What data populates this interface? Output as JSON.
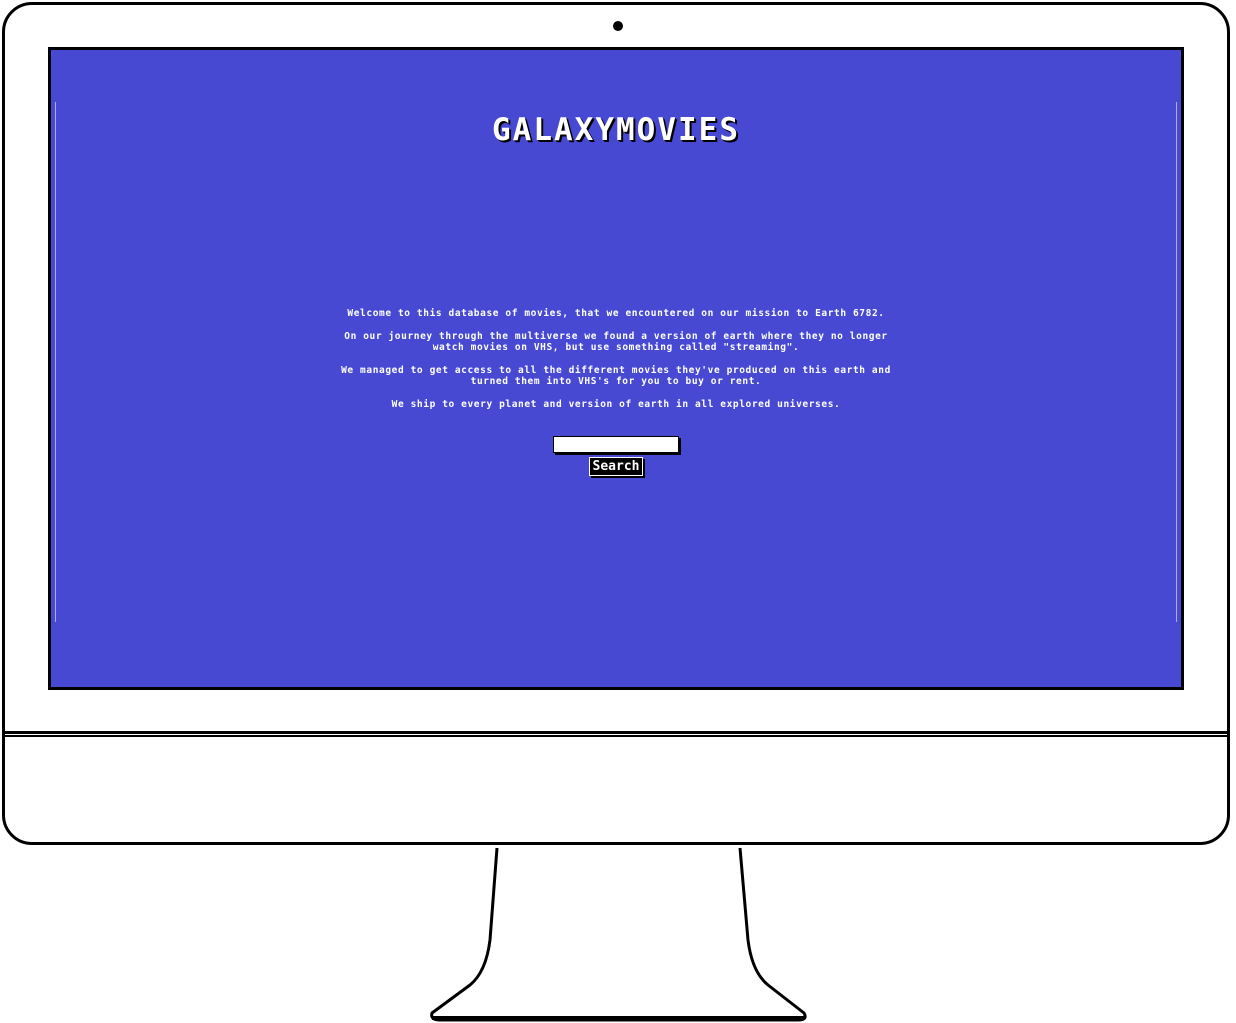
{
  "site": {
    "title": "GALAXYMOVIES"
  },
  "intro": {
    "paragraphs": [
      "Welcome to this database of movies, that we encountered on our mission to Earth 6782.",
      "On our journey through the multiverse we found a version of earth where they no longer watch movies on VHS, but use something called \"streaming\".",
      "We managed to get access to all the different movies they've produced on this earth and turned them into VHS's for you to buy or rent.",
      "We ship to every planet and version of earth in all explored universes."
    ]
  },
  "search": {
    "value": "",
    "placeholder": "",
    "button_label": "Search"
  },
  "colors": {
    "screen_background": "#4749d3",
    "text": "#ffffff",
    "frame": "#000000"
  }
}
